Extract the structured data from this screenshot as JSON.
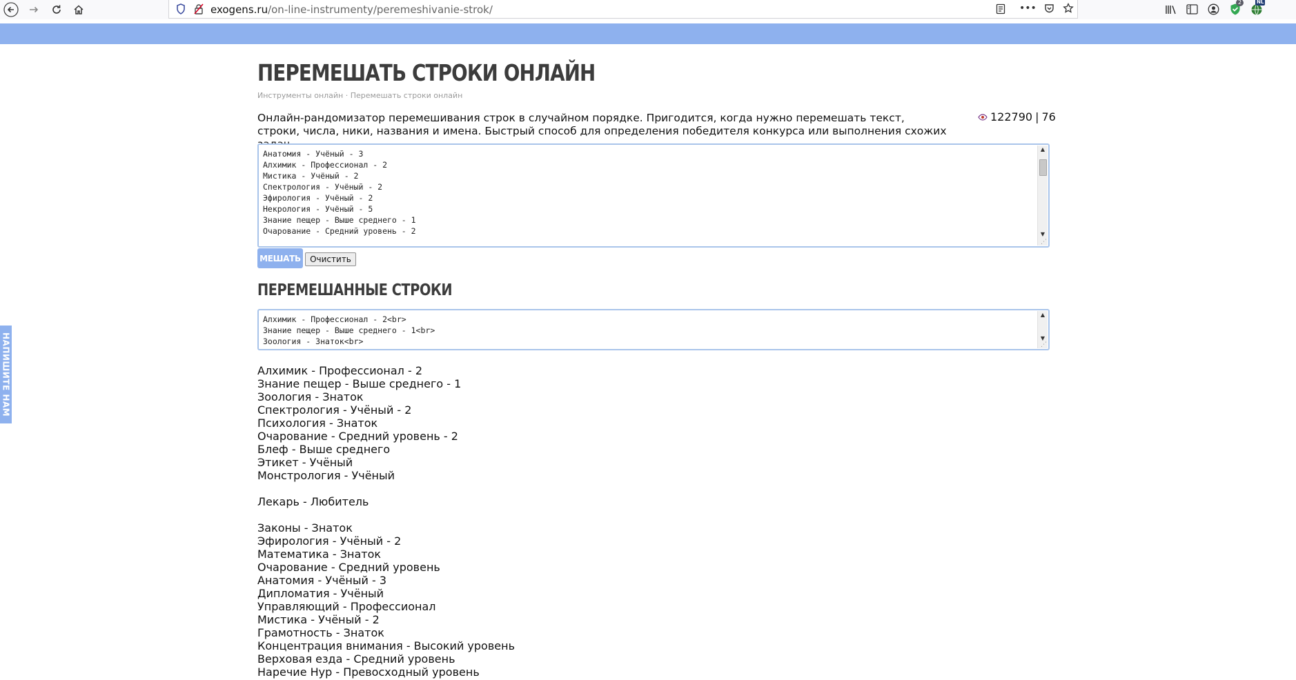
{
  "browser": {
    "url_host": "exogens.ru",
    "url_path": "/on-line-instrumenty/peremeshivanie-strok/",
    "badge_count": "2",
    "badge_locale": "NL"
  },
  "page": {
    "title": "ПЕРЕМЕШАТЬ СТРОКИ ОНЛАЙН",
    "breadcrumb": {
      "home": "Инструменты онлайн",
      "separator": "·",
      "current": "Перемешать строки онлайн"
    },
    "intro": "Онлайн-рандомизатор перемешивания строк в случайном порядке. Пригодится, когда нужно перемешать текст, строки, числа, ники, названия и имена. Быстрый способ для определения победителя конкурса или выполнения схожих задач.",
    "views": "122790",
    "stats_separator": "|",
    "comments": "76"
  },
  "input": {
    "lines": [
      "Анатомия - Учёный - 3",
      "Алхимик - Профессионал - 2",
      "Мистика - Учёный - 2",
      "Спектрология - Учёный - 2",
      "Эфирология - Учёный - 2",
      "Некрология - Учёный - 5",
      "Знание пещер - Выше среднего - 1",
      "Очарование - Средний уровень - 2"
    ]
  },
  "buttons": {
    "mix_label": "МЕШАТЬ",
    "clear_label": "Очистить"
  },
  "result": {
    "section_title": "ПЕРЕМЕШАННЫЕ СТРОКИ",
    "html_lines": [
      "Алхимик - Профессионал - 2<br>",
      "Знание пещер - Выше среднего - 1<br>",
      "Зоология - Знаток<br>"
    ],
    "lines": [
      "Алхимик - Профессионал - 2",
      "Знание пещер - Выше среднего - 1",
      "Зоология - Знаток",
      "Спектрология - Учёный - 2",
      "Психология - Знаток",
      "Очарование - Средний уровень - 2",
      "Блеф - Выше среднего",
      "Этикет - Учёный",
      "Монстрология - Учёный",
      "",
      "Лекарь - Любитель",
      "",
      "Законы - Знаток",
      "Эфирология - Учёный - 2",
      "Математика - Знаток",
      "Очарование - Средний уровень",
      "Анатомия - Учёный - 3",
      "Дипломатия - Учёный",
      "Управляющий - Профессионал",
      "Мистика - Учёный - 2",
      "Грамотность - Знаток",
      "Концентрация внимания - Высокий уровень",
      "Верховая езда - Средний уровень",
      "Наречие Нур - Превосходный уровень"
    ]
  },
  "side_tab": "НАПИШИТЕ НАМ",
  "colors": {
    "accent": "#8eb1ee",
    "heading": "#3c3c3c",
    "textarea_border": "#a9c4ea"
  }
}
